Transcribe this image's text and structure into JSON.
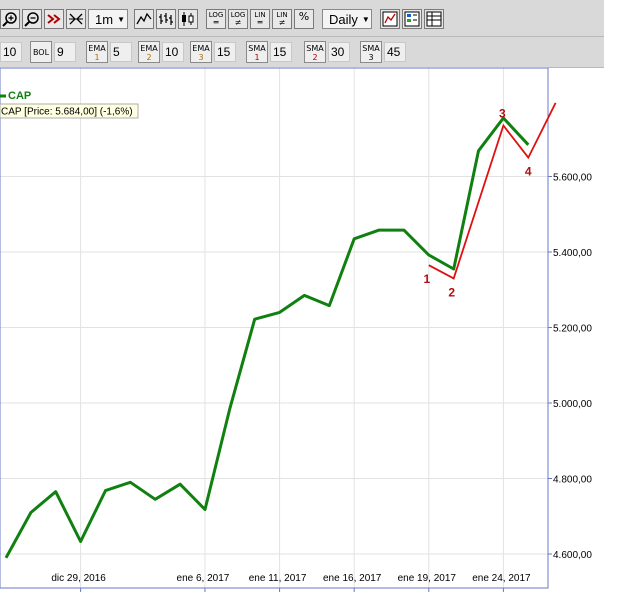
{
  "toolbar": {
    "period_label": "1m",
    "interval_label": "Daily",
    "log_label": "LOG",
    "lin_label": "LIN",
    "pct_label": "%",
    "ne_label": "≠"
  },
  "indicators": [
    {
      "key": "first",
      "value": "10"
    },
    {
      "key": "bol",
      "label": "BOL",
      "value": "9"
    },
    {
      "key": "ema1",
      "label": "EMA",
      "num": "1",
      "value": "5"
    },
    {
      "key": "ema2",
      "label": "EMA",
      "num": "2",
      "value": "10"
    },
    {
      "key": "ema3",
      "label": "EMA",
      "num": "3",
      "value": "15"
    },
    {
      "key": "sma1",
      "label": "SMA",
      "num": "1",
      "value": "15"
    },
    {
      "key": "sma2",
      "label": "SMA",
      "num": "2",
      "value": "30"
    },
    {
      "key": "sma3",
      "label": "SMA",
      "num": "3",
      "value": "45"
    }
  ],
  "chart_data": {
    "type": "line",
    "legend_label": "CAP",
    "price_info": "CAP [Price: 5.684,00] (-1,6%)",
    "x_ticks": [
      "dic 29, 2016",
      "ene 6, 2017",
      "ene 11, 2017",
      "ene 16, 2017",
      "ene 19, 2017",
      "ene 24, 2017"
    ],
    "y_ticks": [
      "4.600,00",
      "4.800,00",
      "5.000,00",
      "5.200,00",
      "5.400,00",
      "5.600,00"
    ],
    "ylim": [
      4580,
      5780
    ],
    "series": [
      {
        "name": "CAP",
        "color": "#108010",
        "values": [
          4590,
          4710,
          4765,
          4633,
          4768,
          4790,
          4745,
          4785,
          4718,
          4985,
          5222,
          5240,
          5285,
          5258,
          5435,
          5458,
          5458,
          5392,
          5355,
          5668,
          5755,
          5684
        ]
      }
    ],
    "wave_annotation": {
      "color": "#e01010",
      "label_color": "#b01010",
      "points": [
        {
          "x": 17,
          "y": 5365,
          "label": "1"
        },
        {
          "x": 18,
          "y": 5330,
          "label": "2"
        },
        {
          "x": 20,
          "y": 5735,
          "label": "3"
        },
        {
          "x": 21,
          "y": 5650,
          "label": "4"
        },
        {
          "x": 22.1,
          "y": 5795,
          "label": ""
        }
      ]
    },
    "grid": true,
    "legend_position": "top-left"
  }
}
